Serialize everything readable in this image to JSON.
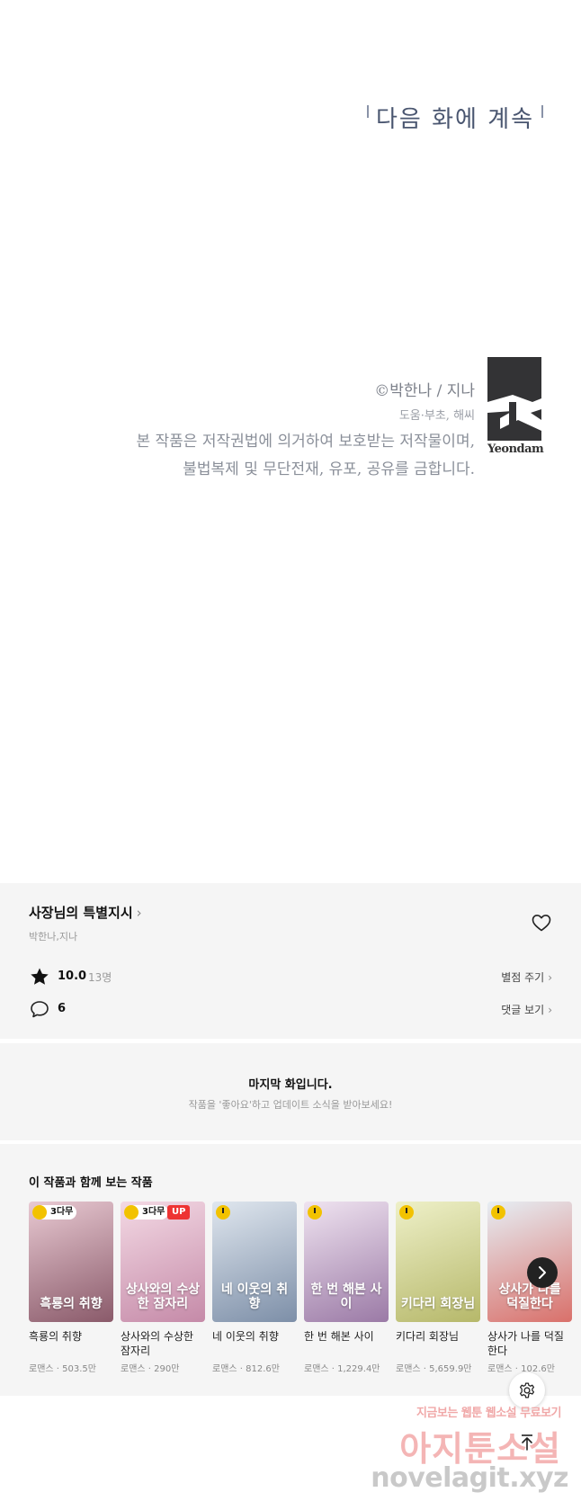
{
  "comic": {
    "next_episode": "다음 화에 계속",
    "copyright": "©박한나 / 지나",
    "assist": "도움·부초, 해씨",
    "notice_line1": "본 작품은 저작권법에 의거하여 보호받는 저작물이며,",
    "notice_line2": "불법복제 및 무단전재, 유포, 공유를 금합니다.",
    "logo_text": "Yeondam"
  },
  "work": {
    "title": "사장님의 특별지시",
    "author": "박한나,지나",
    "rating": "10.0",
    "rating_count": "13명",
    "rate_action": "별점 주기",
    "comment_count": "6",
    "comment_action": "댓글 보기"
  },
  "last_episode": {
    "heading": "마지막 화입니다.",
    "subtext": "작품을 '좋아요'하고 업데이트 소식을 받아보세요!"
  },
  "recommendations": {
    "heading": "이 작품과 함께 보는 작품",
    "items": [
      {
        "name": "흑룡의 취향",
        "meta": "로맨스 · 503.5만",
        "badge": "3다무",
        "up": "",
        "cover_text": "흑룡의 취향",
        "color_a": "#e8c9d2",
        "color_b": "#8a5a6a"
      },
      {
        "name": "상사와의 수상한 잠자리",
        "meta": "로맨스 · 290만",
        "badge": "3다무",
        "up": "UP",
        "cover_text": "상사와의 수상한 잠자리",
        "color_a": "#f3d9e4",
        "color_b": "#c58aa8"
      },
      {
        "name": "네 이웃의 취향",
        "meta": "로맨스 · 812.6만",
        "badge": "",
        "up": "",
        "cover_text": "네 이웃의 취향",
        "color_a": "#dfe6ee",
        "color_b": "#7d8fa8"
      },
      {
        "name": "한 번 해본 사이",
        "meta": "로맨스 · 1,229.4만",
        "badge": "",
        "up": "",
        "cover_text": "한 번 해본 사이",
        "color_a": "#efe3f0",
        "color_b": "#9b7aa6"
      },
      {
        "name": "키다리 회장님",
        "meta": "로맨스 · 5,659.9만",
        "badge": "",
        "up": "",
        "cover_text": "키다리 회장님",
        "color_a": "#eef0c8",
        "color_b": "#b6b86a"
      },
      {
        "name": "상사가 나를 덕질한다",
        "meta": "로맨스 · 102.6만",
        "badge": "",
        "up": "",
        "cover_text": "상사가 나를 덕질한다",
        "color_a": "#e6eef4",
        "color_b": "#d9706a"
      }
    ]
  },
  "watermark": {
    "line1": "지금보는 웹툰 웹소설 무료보기",
    "line2": "아지툰소설",
    "line3": "novelagit.xyz"
  },
  "icons": {
    "heart": "heart-icon",
    "star": "star-icon",
    "comment": "comment-icon",
    "next": "chevron-right-icon",
    "settings": "gear-icon",
    "top": "arrow-up-icon"
  }
}
